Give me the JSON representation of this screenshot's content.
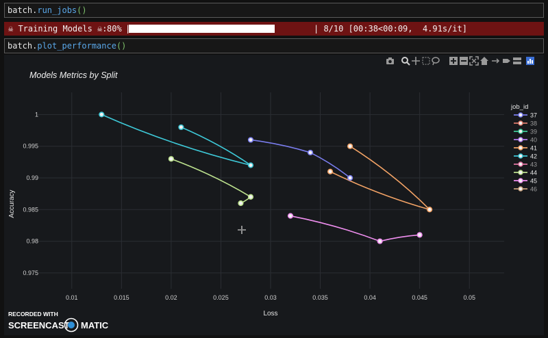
{
  "cells": {
    "run_jobs": {
      "obj": "batch.",
      "fn": "run_jobs",
      "paren": "()"
    },
    "plot_performance": {
      "obj": "batch.",
      "fn": "plot_performance",
      "paren": "()"
    }
  },
  "progress": {
    "label": "☠ Training Models ☠:",
    "percent_text": "80%",
    "fraction": 0.8,
    "stats": "| 8/10 [00:38<00:09,  4.91s/it]"
  },
  "watermark": {
    "line1": "RECORDED WITH",
    "brand_left": "SCREENCAST",
    "brand_right": "MATIC"
  },
  "modebar": {
    "icons": [
      "camera-icon",
      "zoom-icon",
      "pan-icon",
      "box-select-icon",
      "lasso-icon",
      "zoom-in-icon",
      "zoom-out-icon",
      "autoscale-icon",
      "reset-axes-icon",
      "spike-lines-icon",
      "hover-closest-icon",
      "hover-compare-icon",
      "plotly-logo-icon"
    ]
  },
  "chart_data": {
    "type": "line",
    "title": "Models Metrics by Split",
    "xlabel": "Loss",
    "ylabel": "Accuracy",
    "xlim": [
      0.0065,
      0.0535
    ],
    "ylim": [
      0.9725,
      1.0035
    ],
    "xticks": [
      "0.01",
      "0.015",
      "0.02",
      "0.025",
      "0.03",
      "0.035",
      "0.04",
      "0.045",
      "0.05"
    ],
    "xtick_values": [
      0.01,
      0.015,
      0.02,
      0.025,
      0.03,
      0.035,
      0.04,
      0.045,
      0.05
    ],
    "yticks": [
      "0.975",
      "0.98",
      "0.985",
      "0.99",
      "0.995",
      "1"
    ],
    "ytick_values": [
      0.975,
      0.98,
      0.985,
      0.99,
      0.995,
      1
    ],
    "grid": true,
    "legend_title": "job_id",
    "legend_position": "right",
    "series": [
      {
        "name": "37",
        "color": "#7b7ef0",
        "x": [
          0.028,
          0.034,
          0.038
        ],
        "y": [
          0.996,
          0.994,
          0.99
        ]
      },
      {
        "name": "38",
        "color": "#e07b6c",
        "x": [],
        "y": []
      },
      {
        "name": "39",
        "color": "#41cc9b",
        "x": [],
        "y": []
      },
      {
        "name": "40",
        "color": "#b57cf0",
        "x": [],
        "y": []
      },
      {
        "name": "41",
        "color": "#f3a366",
        "x": [
          0.038,
          0.046,
          0.036
        ],
        "y": [
          0.995,
          0.985,
          0.991
        ]
      },
      {
        "name": "42",
        "color": "#3ec9d8",
        "x": [
          0.021,
          0.028,
          0.013
        ],
        "y": [
          0.998,
          0.992,
          1.0
        ]
      },
      {
        "name": "43",
        "color": "#e577a5",
        "x": [],
        "y": []
      },
      {
        "name": "44",
        "color": "#bde28e",
        "x": [
          0.02,
          0.028,
          0.027
        ],
        "y": [
          0.993,
          0.987,
          0.986
        ]
      },
      {
        "name": "45",
        "color": "#f08ff0",
        "x": [
          0.032,
          0.041,
          0.045
        ],
        "y": [
          0.984,
          0.98,
          0.981
        ]
      },
      {
        "name": "46",
        "color": "#c9a27c",
        "x": [],
        "y": []
      }
    ]
  }
}
